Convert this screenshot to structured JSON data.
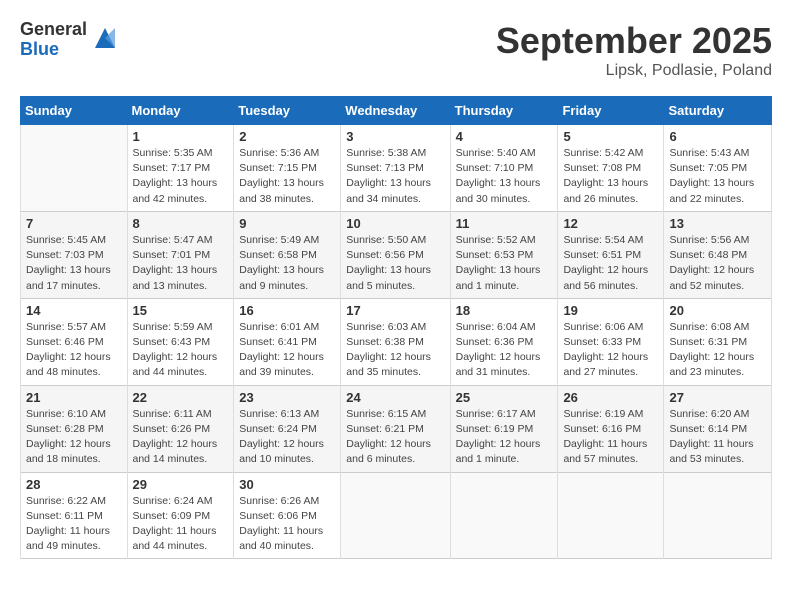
{
  "logo": {
    "general": "General",
    "blue": "Blue"
  },
  "title": "September 2025",
  "location": "Lipsk, Podlasie, Poland",
  "days_header": [
    "Sunday",
    "Monday",
    "Tuesday",
    "Wednesday",
    "Thursday",
    "Friday",
    "Saturday"
  ],
  "weeks": [
    [
      {
        "day": "",
        "info": ""
      },
      {
        "day": "1",
        "info": "Sunrise: 5:35 AM\nSunset: 7:17 PM\nDaylight: 13 hours\nand 42 minutes."
      },
      {
        "day": "2",
        "info": "Sunrise: 5:36 AM\nSunset: 7:15 PM\nDaylight: 13 hours\nand 38 minutes."
      },
      {
        "day": "3",
        "info": "Sunrise: 5:38 AM\nSunset: 7:13 PM\nDaylight: 13 hours\nand 34 minutes."
      },
      {
        "day": "4",
        "info": "Sunrise: 5:40 AM\nSunset: 7:10 PM\nDaylight: 13 hours\nand 30 minutes."
      },
      {
        "day": "5",
        "info": "Sunrise: 5:42 AM\nSunset: 7:08 PM\nDaylight: 13 hours\nand 26 minutes."
      },
      {
        "day": "6",
        "info": "Sunrise: 5:43 AM\nSunset: 7:05 PM\nDaylight: 13 hours\nand 22 minutes."
      }
    ],
    [
      {
        "day": "7",
        "info": "Sunrise: 5:45 AM\nSunset: 7:03 PM\nDaylight: 13 hours\nand 17 minutes."
      },
      {
        "day": "8",
        "info": "Sunrise: 5:47 AM\nSunset: 7:01 PM\nDaylight: 13 hours\nand 13 minutes."
      },
      {
        "day": "9",
        "info": "Sunrise: 5:49 AM\nSunset: 6:58 PM\nDaylight: 13 hours\nand 9 minutes."
      },
      {
        "day": "10",
        "info": "Sunrise: 5:50 AM\nSunset: 6:56 PM\nDaylight: 13 hours\nand 5 minutes."
      },
      {
        "day": "11",
        "info": "Sunrise: 5:52 AM\nSunset: 6:53 PM\nDaylight: 13 hours\nand 1 minute."
      },
      {
        "day": "12",
        "info": "Sunrise: 5:54 AM\nSunset: 6:51 PM\nDaylight: 12 hours\nand 56 minutes."
      },
      {
        "day": "13",
        "info": "Sunrise: 5:56 AM\nSunset: 6:48 PM\nDaylight: 12 hours\nand 52 minutes."
      }
    ],
    [
      {
        "day": "14",
        "info": "Sunrise: 5:57 AM\nSunset: 6:46 PM\nDaylight: 12 hours\nand 48 minutes."
      },
      {
        "day": "15",
        "info": "Sunrise: 5:59 AM\nSunset: 6:43 PM\nDaylight: 12 hours\nand 44 minutes."
      },
      {
        "day": "16",
        "info": "Sunrise: 6:01 AM\nSunset: 6:41 PM\nDaylight: 12 hours\nand 39 minutes."
      },
      {
        "day": "17",
        "info": "Sunrise: 6:03 AM\nSunset: 6:38 PM\nDaylight: 12 hours\nand 35 minutes."
      },
      {
        "day": "18",
        "info": "Sunrise: 6:04 AM\nSunset: 6:36 PM\nDaylight: 12 hours\nand 31 minutes."
      },
      {
        "day": "19",
        "info": "Sunrise: 6:06 AM\nSunset: 6:33 PM\nDaylight: 12 hours\nand 27 minutes."
      },
      {
        "day": "20",
        "info": "Sunrise: 6:08 AM\nSunset: 6:31 PM\nDaylight: 12 hours\nand 23 minutes."
      }
    ],
    [
      {
        "day": "21",
        "info": "Sunrise: 6:10 AM\nSunset: 6:28 PM\nDaylight: 12 hours\nand 18 minutes."
      },
      {
        "day": "22",
        "info": "Sunrise: 6:11 AM\nSunset: 6:26 PM\nDaylight: 12 hours\nand 14 minutes."
      },
      {
        "day": "23",
        "info": "Sunrise: 6:13 AM\nSunset: 6:24 PM\nDaylight: 12 hours\nand 10 minutes."
      },
      {
        "day": "24",
        "info": "Sunrise: 6:15 AM\nSunset: 6:21 PM\nDaylight: 12 hours\nand 6 minutes."
      },
      {
        "day": "25",
        "info": "Sunrise: 6:17 AM\nSunset: 6:19 PM\nDaylight: 12 hours\nand 1 minute."
      },
      {
        "day": "26",
        "info": "Sunrise: 6:19 AM\nSunset: 6:16 PM\nDaylight: 11 hours\nand 57 minutes."
      },
      {
        "day": "27",
        "info": "Sunrise: 6:20 AM\nSunset: 6:14 PM\nDaylight: 11 hours\nand 53 minutes."
      }
    ],
    [
      {
        "day": "28",
        "info": "Sunrise: 6:22 AM\nSunset: 6:11 PM\nDaylight: 11 hours\nand 49 minutes."
      },
      {
        "day": "29",
        "info": "Sunrise: 6:24 AM\nSunset: 6:09 PM\nDaylight: 11 hours\nand 44 minutes."
      },
      {
        "day": "30",
        "info": "Sunrise: 6:26 AM\nSunset: 6:06 PM\nDaylight: 11 hours\nand 40 minutes."
      },
      {
        "day": "",
        "info": ""
      },
      {
        "day": "",
        "info": ""
      },
      {
        "day": "",
        "info": ""
      },
      {
        "day": "",
        "info": ""
      }
    ]
  ]
}
